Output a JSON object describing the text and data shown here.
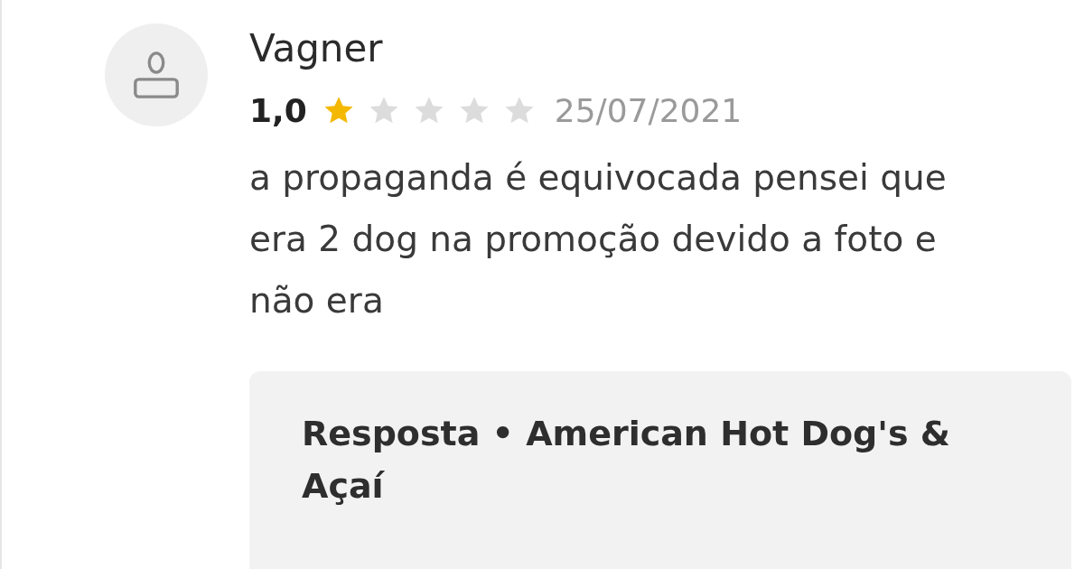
{
  "review": {
    "author": "Vagner",
    "score": "1,0",
    "stars": 1,
    "date": "25/07/2021",
    "text": "a propaganda é equivocada pensei que era 2 dog na promoção devido a foto e não era"
  },
  "reply": {
    "title": "Resposta • American Hot Dog's & Açaí"
  }
}
